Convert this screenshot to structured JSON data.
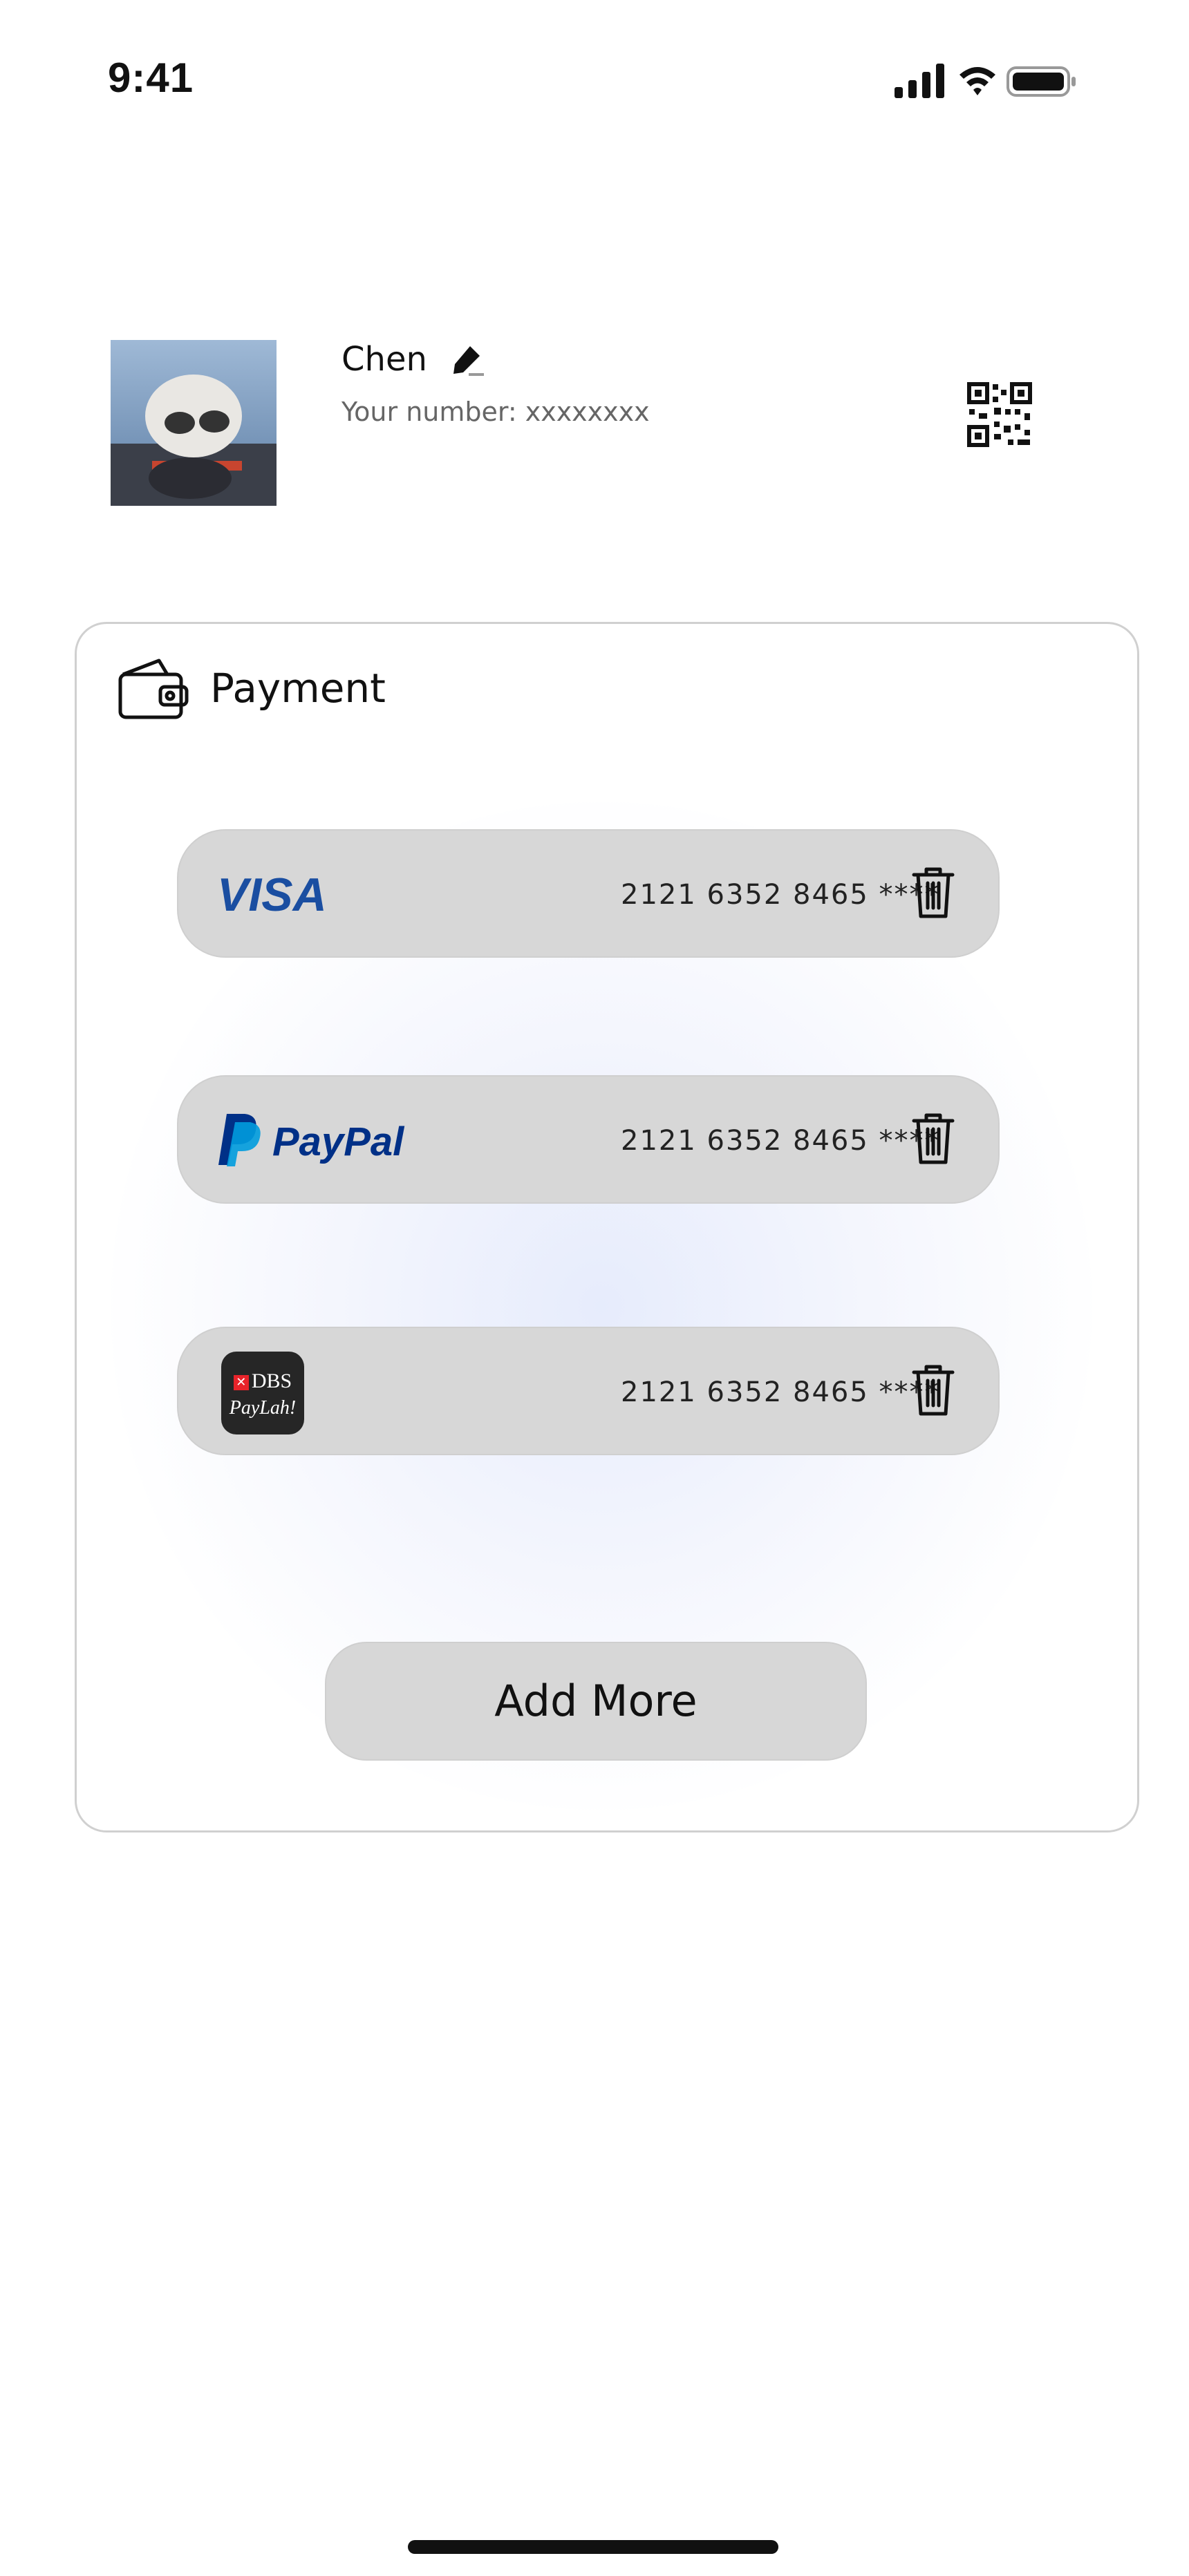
{
  "status_bar": {
    "time": "9:41"
  },
  "profile": {
    "name": "Chen",
    "number_line": "Your number: xxxxxxxx"
  },
  "payment": {
    "title": "Payment",
    "methods": [
      {
        "brand": "VISA",
        "number": "2121 6352 8465 ****"
      },
      {
        "brand": "PayPal",
        "number": "2121 6352 8465 ****"
      },
      {
        "brand_top": "DBS",
        "brand_bottom": "PayLah!",
        "number": "2121 6352 8465 ****"
      }
    ],
    "add_more_label": "Add More"
  },
  "colors": {
    "card_bg": "#d7d7d7",
    "visa_blue": "#1a4ea1",
    "paypal_dark": "#003087",
    "paypal_light": "#009cde",
    "dbs_red": "#e8232a"
  }
}
